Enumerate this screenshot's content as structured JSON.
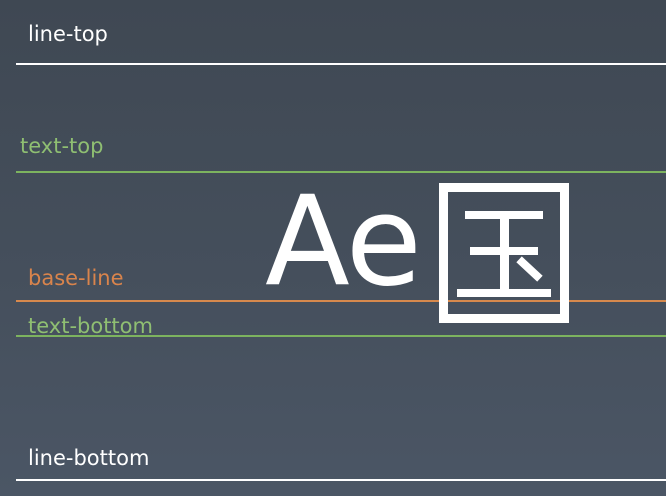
{
  "colors": {
    "white": "#ffffff",
    "green": "#8fbf72",
    "orange": "#d9844c",
    "line_green": "#7db35f",
    "line_orange": "#d7894d"
  },
  "labels": {
    "line_top": "line-top",
    "text_top": "text-top",
    "base_line": "base-line",
    "text_bottom": "text-bottom",
    "line_bottom": "line-bottom"
  },
  "sample": {
    "latin": "Ae",
    "cjk": "国"
  }
}
